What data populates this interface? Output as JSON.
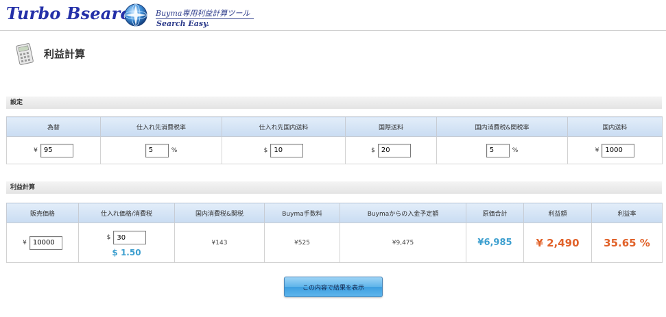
{
  "header": {
    "brand": "Turbo Bsearch",
    "tagline": "Buyma専用利益計算ツール",
    "sub_tagline": "Search Easy."
  },
  "page": {
    "title": "利益計算",
    "icon": "calculator-icon"
  },
  "settings": {
    "section_label": "設定",
    "columns": [
      "為替",
      "仕入れ先消費税率",
      "仕入れ先国内送料",
      "国際送料",
      "国内消費税&関税率",
      "国内送料"
    ],
    "exchange_rate": {
      "currency": "¥",
      "value": "95"
    },
    "supplier_tax_rate": {
      "value": "5",
      "unit": "%"
    },
    "supplier_domestic_shipping": {
      "currency": "$",
      "value": "10"
    },
    "international_shipping": {
      "currency": "$",
      "value": "20"
    },
    "domestic_tax_duty_rate": {
      "value": "5",
      "unit": "%"
    },
    "domestic_shipping": {
      "currency": "¥",
      "value": "1000"
    }
  },
  "profit": {
    "section_label": "利益計算",
    "columns": [
      "販売価格",
      "仕入れ価格/消費税",
      "国内消費税&関税",
      "Buyma手数料",
      "Buymaからの入金予定額",
      "原価合計",
      "利益額",
      "利益率"
    ],
    "sale_price": {
      "currency": "¥",
      "value": "10000"
    },
    "purchase_price": {
      "currency": "$",
      "value": "30",
      "usd_with_tax": "$ 1.50"
    },
    "domestic_tax_duty": "¥143",
    "buyma_fee": "¥525",
    "buyma_deposit": "¥9,475",
    "total_cost": "¥6,985",
    "profit_amount": "¥ 2,490",
    "profit_rate": "35.65 %"
  },
  "actions": {
    "submit_label": "この内容で結果を表示"
  },
  "colors": {
    "brand": "#2430a8",
    "header_cell": "#c9dcf2",
    "accent_blue": "#3d9fcf",
    "accent_orange": "#e1622a",
    "button": "#5fb4ea"
  }
}
